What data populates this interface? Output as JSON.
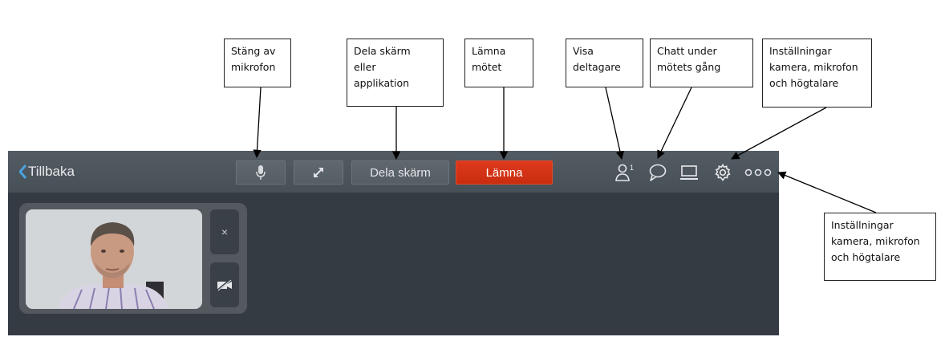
{
  "callouts": {
    "mute": "Stäng av\nmikrofon",
    "share": "Dela skärm\neller\napplikation",
    "leave": "Lämna\nmötet",
    "participants": "Visa\ndeltagare",
    "chat": "Chatt under\nmötets gång",
    "settings": "Inställningar\nkamera, mikrofon\noch högtalare",
    "more": "Inställningar\nkamera, mikrofon\noch högtalare"
  },
  "toolbar": {
    "back_label": "Tillbaka",
    "share_label": "Dela skärm",
    "leave_label": "Lämna",
    "participant_count": "1"
  },
  "video_panel": {
    "close_symbol": "×"
  },
  "colors": {
    "toolbar": "#4d555d",
    "background": "#343b43",
    "leave": "#d4341a",
    "back_accent": "#4aa3e0"
  }
}
